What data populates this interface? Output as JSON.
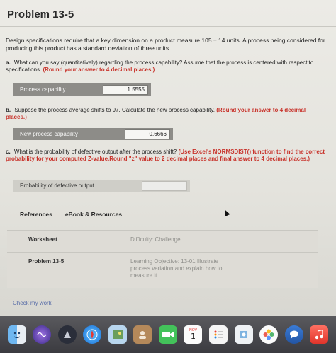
{
  "page": {
    "title": "Problem 13-5",
    "intro": "Design specifications require that a key dimension on a product measure 105 ± 14 units. A process being considered for producing this product has a standard deviation of three units."
  },
  "questions": {
    "a": {
      "letter": "a.",
      "text": "What can you say (quantitatively) regarding the process capability? Assume that the process is centered with respect to specifications.",
      "red": "(Round your answer to 4 decimal places.)",
      "answer_label": "Process capability",
      "answer_value": "1.5555"
    },
    "b": {
      "letter": "b.",
      "text": "Suppose the process average shifts to 97. Calculate the new process capability.",
      "red": "(Round your answer to 4 decimal places.)",
      "answer_label": "New process capability",
      "answer_value": "0.6666"
    },
    "c": {
      "letter": "c.",
      "text": "What is the probability of defective output after the process shift?",
      "red": "(Use Excel's NORMSDIST() function to find the correct probability for your computed Z-value.Round \"z\" value to 2 decimal places and final answer to 4 decimal places.)",
      "answer_label": "Probability of defective output",
      "answer_value": ""
    }
  },
  "tabs": {
    "references": "References",
    "ebook": "eBook & Resources"
  },
  "info": {
    "worksheet_label": "Worksheet",
    "difficulty": "Difficulty: Challenge",
    "problem_label": "Problem 13-5",
    "learning_objective": "Learning Objective: 13-01 Illustrate process variation and explain how to measure it."
  },
  "footer": {
    "check_work": "Check my work"
  },
  "dock": {
    "calendar_day": "1",
    "calendar_month": "NOV"
  },
  "colors": {
    "accent_red": "#c8322a",
    "answer_bar": "#8d8c88",
    "link_blue": "#5a6ea8"
  }
}
